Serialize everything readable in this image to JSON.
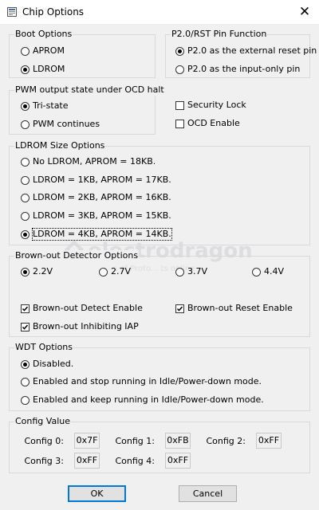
{
  "window": {
    "title": "Chip Options",
    "close_glyph": "✕"
  },
  "boot": {
    "legend": "Boot Options",
    "options": [
      {
        "label": "APROM",
        "checked": false
      },
      {
        "label": "LDROM",
        "checked": true
      }
    ]
  },
  "p20": {
    "legend": "P2.0/RST Pin Function",
    "options": [
      {
        "label": "P2.0 as the external reset pin",
        "checked": true
      },
      {
        "label": "P2.0 as the input-only pin",
        "checked": false
      }
    ]
  },
  "pwm": {
    "legend": "PWM output state under OCD halt",
    "options": [
      {
        "label": "Tri-state",
        "checked": true
      },
      {
        "label": "PWM continues",
        "checked": false
      }
    ]
  },
  "security_lock": {
    "label": "Security Lock",
    "checked": false
  },
  "ocd_enable": {
    "label": "OCD Enable",
    "checked": false
  },
  "ldrom": {
    "legend": "LDROM Size Options",
    "options": [
      {
        "label": "No LDROM, APROM = 18KB.",
        "checked": false
      },
      {
        "label": "LDROM = 1KB, APROM = 17KB.",
        "checked": false
      },
      {
        "label": "LDROM = 2KB, APROM = 16KB.",
        "checked": false
      },
      {
        "label": "LDROM = 3KB, APROM = 15KB.",
        "checked": false
      },
      {
        "label": "LDROM = 4KB, APROM = 14KB.",
        "checked": true
      }
    ]
  },
  "bod": {
    "legend": "Brown-out Detector Options",
    "voltages": [
      {
        "label": "2.2V",
        "checked": true
      },
      {
        "label": "2.7V",
        "checked": false
      },
      {
        "label": "3.7V",
        "checked": false
      },
      {
        "label": "4.4V",
        "checked": false
      }
    ],
    "detect_enable": {
      "label": "Brown-out Detect Enable",
      "checked": true
    },
    "reset_enable": {
      "label": "Brown-out Reset Enable",
      "checked": true
    },
    "inhibit_iap": {
      "label": "Brown-out Inhibiting IAP",
      "checked": true
    }
  },
  "wdt": {
    "legend": "WDT Options",
    "options": [
      {
        "label": "Disabled.",
        "checked": true
      },
      {
        "label": "Enabled and stop running in Idle/Power-down mode.",
        "checked": false
      },
      {
        "label": "Enabled and keep running in Idle/Power-down mode.",
        "checked": false
      }
    ]
  },
  "config": {
    "legend": "Config Value",
    "items": [
      {
        "label": "Config 0:",
        "value": "0x7F"
      },
      {
        "label": "Config 1:",
        "value": "0xFB"
      },
      {
        "label": "Config 2:",
        "value": "0xFF"
      },
      {
        "label": "Config 3:",
        "value": "0xFF"
      },
      {
        "label": "Config 4:",
        "value": "0xFF"
      }
    ]
  },
  "buttons": {
    "ok": "OK",
    "cancel": "Cancel"
  },
  "watermark": {
    "main": "electrodragon",
    "sub": "s of Proto... ts online"
  },
  "colors": {
    "accent": "#0078d7",
    "border": "#d9d9d9",
    "background": "#f0f0f0"
  }
}
